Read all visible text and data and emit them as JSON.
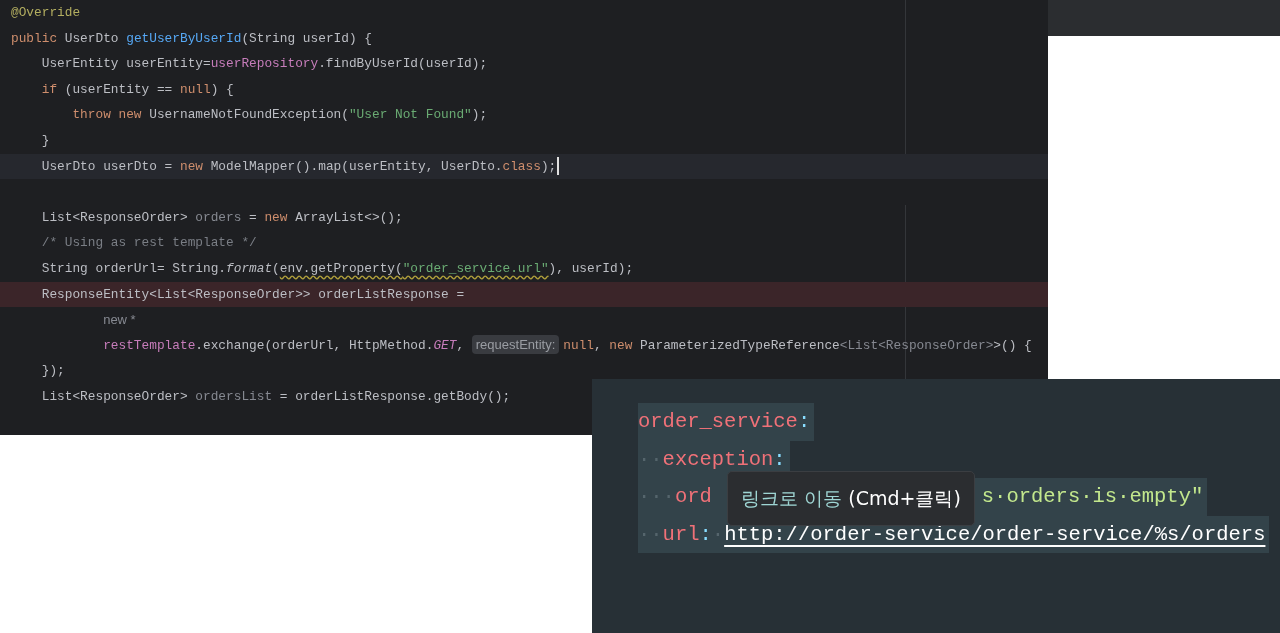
{
  "editor": {
    "lines": [
      {
        "tokens": [
          {
            "kind": "annotation",
            "text": "@Override"
          }
        ]
      },
      {
        "tokens": [
          {
            "kind": "keyword",
            "text": "public"
          },
          {
            "kind": "plain",
            "text": " UserDto "
          },
          {
            "kind": "method",
            "text": "getUserByUserId"
          },
          {
            "kind": "plain",
            "text": "(String userId) {"
          }
        ]
      },
      {
        "tokens": [
          {
            "kind": "plain",
            "text": "    UserEntity userEntity="
          },
          {
            "kind": "field",
            "text": "userRepository"
          },
          {
            "kind": "plain",
            "text": ".findByUserId(userId);"
          }
        ]
      },
      {
        "tokens": [
          {
            "kind": "keyword",
            "text": "    if"
          },
          {
            "kind": "plain",
            "text": " (userEntity == "
          },
          {
            "kind": "keyword",
            "text": "null"
          },
          {
            "kind": "plain",
            "text": ") {"
          }
        ]
      },
      {
        "tokens": [
          {
            "kind": "keyword",
            "text": "        throw new"
          },
          {
            "kind": "plain",
            "text": " UsernameNotFoundException("
          },
          {
            "kind": "string",
            "text": "\"User Not Found\""
          },
          {
            "kind": "plain",
            "text": ");"
          }
        ]
      },
      {
        "tokens": [
          {
            "kind": "plain",
            "text": "    }"
          }
        ]
      },
      {
        "current_line": true,
        "caret": true,
        "tokens": [
          {
            "kind": "plain",
            "text": "    UserDto userDto = "
          },
          {
            "kind": "keyword",
            "text": "new"
          },
          {
            "kind": "plain",
            "text": " ModelMapper().map(userEntity, UserDto."
          },
          {
            "kind": "keyword",
            "text": "class"
          },
          {
            "kind": "plain",
            "text": ");"
          }
        ]
      },
      {
        "kind": "blank"
      },
      {
        "tokens": [
          {
            "kind": "plain",
            "text": "    List<ResponseOrder> "
          },
          {
            "kind": "unused",
            "text": "orders"
          },
          {
            "kind": "plain",
            "text": " = "
          },
          {
            "kind": "keyword",
            "text": "new"
          },
          {
            "kind": "plain",
            "text": " ArrayList<>();"
          }
        ]
      },
      {
        "tokens": [
          {
            "kind": "comment",
            "text": "    /* Using as rest template */"
          }
        ]
      },
      {
        "tokens": [
          {
            "kind": "plain",
            "text": "    String orderUrl= String."
          },
          {
            "kind": "static",
            "text": "format"
          },
          {
            "kind": "plain",
            "text": "("
          },
          {
            "kind": "plain",
            "text": "env.getProperty(",
            "warning": true
          },
          {
            "kind": "string",
            "text": "\"order_service.url\"",
            "warning": true
          },
          {
            "kind": "plain",
            "text": "), userId);"
          }
        ]
      },
      {
        "error": true,
        "tokens": [
          {
            "kind": "plain",
            "text": "    ResponseEntity<List<ResponseOrder>> orderListResponse ="
          }
        ]
      },
      {
        "tokens": [
          {
            "kind": "hint",
            "text": "            new *"
          }
        ]
      },
      {
        "tokens": [
          {
            "kind": "field",
            "text": "            restTemplate"
          },
          {
            "kind": "plain",
            "text": ".exchange(orderUrl, HttpMethod."
          },
          {
            "kind": "constant",
            "text": "GET"
          },
          {
            "kind": "plain",
            "text": ", "
          },
          {
            "kind": "chip",
            "text": "requestEntity:"
          },
          {
            "kind": "keyword",
            "text": "null"
          },
          {
            "kind": "plain",
            "text": ", "
          },
          {
            "kind": "keyword",
            "text": "new"
          },
          {
            "kind": "plain",
            "text": " ParameterizedTypeReference"
          },
          {
            "kind": "unused",
            "text": "<List<ResponseOrder>"
          },
          {
            "kind": "plain",
            "text": ">() {"
          }
        ]
      },
      {
        "tokens": [
          {
            "kind": "plain",
            "text": "    });"
          }
        ]
      },
      {
        "tokens": [
          {
            "kind": "plain",
            "text": "    List<ResponseOrder> "
          },
          {
            "kind": "unused",
            "text": "ordersList"
          },
          {
            "kind": "plain",
            "text": " = orderListResponse.getBody();"
          }
        ]
      }
    ]
  },
  "yaml": {
    "lines": [
      {
        "tokens": [
          {
            "kind": "key",
            "text": "order_service"
          },
          {
            "kind": "punct",
            "text": ":"
          }
        ]
      },
      {
        "tokens": [
          {
            "kind": "space",
            "text": "··"
          },
          {
            "kind": "key",
            "text": "exception"
          },
          {
            "kind": "punct",
            "text": ":"
          }
        ]
      },
      {
        "tokens": [
          {
            "kind": "space",
            "text": "···"
          },
          {
            "kind": "key",
            "text": "ord"
          },
          {
            "kind": "gap"
          },
          {
            "kind": "value",
            "text": "s·orders·is·empty\""
          }
        ]
      },
      {
        "tokens": [
          {
            "kind": "space",
            "text": "··"
          },
          {
            "kind": "key",
            "text": "url"
          },
          {
            "kind": "punct",
            "text": ":"
          },
          {
            "kind": "space",
            "text": "·"
          },
          {
            "kind": "link",
            "text": "http://order-service/order-service/%s/orders"
          }
        ]
      }
    ],
    "tooltip": {
      "action": "링크로 이동",
      "shortcut": "(Cmd+클릭)"
    }
  }
}
